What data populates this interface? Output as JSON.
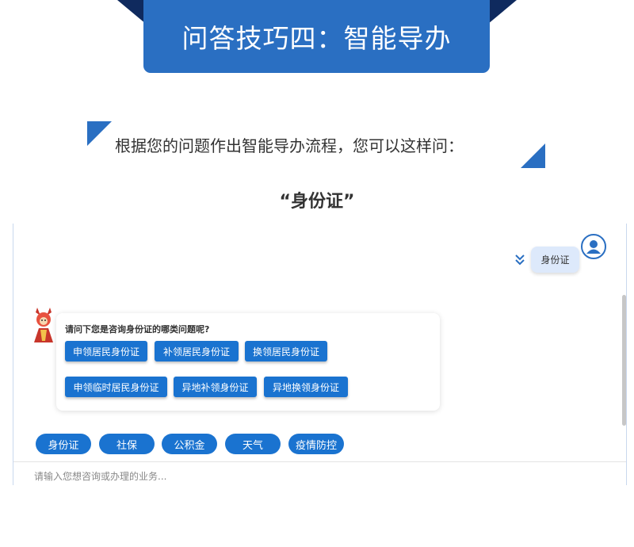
{
  "banner": {
    "title": "问答技巧四：智能导办"
  },
  "intro": {
    "text": "根据您的问题作出智能导办流程，您可以这样问："
  },
  "example": {
    "query": "“身份证”"
  },
  "chat": {
    "user_message": "身份证",
    "bot_question": "请问下您是咨询身份证的哪类问题呢?",
    "options": [
      "申领居民身份证",
      "补领居民身份证",
      "换领居民身份证",
      "申领临时居民身份证",
      "异地补领身份证",
      "异地换领身份证"
    ],
    "quick_replies": [
      "身份证",
      "社保",
      "公积金",
      "天气",
      "疫情防控"
    ],
    "input_placeholder": "请输入您想咨询或办理的业务..."
  },
  "icons": {
    "user_avatar": "user-icon",
    "bot_avatar": "mascot-icon",
    "chevron": "double-chevron-down-icon"
  },
  "colors": {
    "accent": "#2a6fc2",
    "button": "#1a73d0",
    "banner_wing": "#0f2a5e",
    "user_bubble": "#dde9fb"
  }
}
